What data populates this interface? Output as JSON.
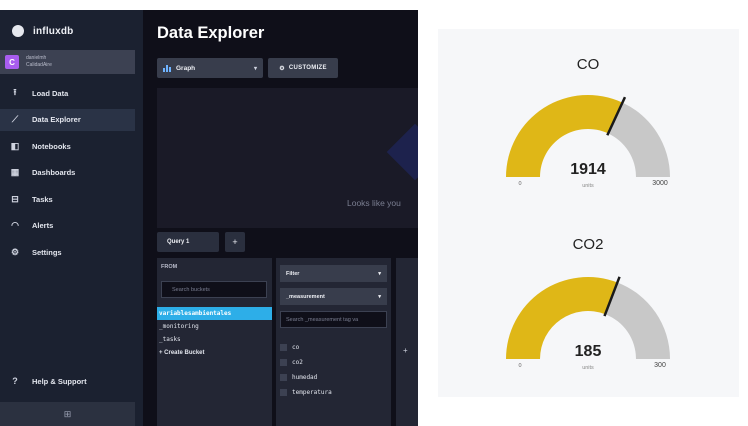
{
  "influx": {
    "brand": "influxdb",
    "org": {
      "avatar_letter": "C",
      "line1": "danielmh",
      "line2": "CalidadAire"
    },
    "nav": [
      {
        "label": "Load Data",
        "icon": "upload-icon",
        "glyph": "⭱",
        "active": false
      },
      {
        "label": "Data Explorer",
        "icon": "graph-icon",
        "glyph": "⟋",
        "active": true
      },
      {
        "label": "Notebooks",
        "icon": "notebook-icon",
        "glyph": "◧",
        "active": false
      },
      {
        "label": "Dashboards",
        "icon": "dashboard-icon",
        "glyph": "▦",
        "active": false
      },
      {
        "label": "Tasks",
        "icon": "calendar-icon",
        "glyph": "⊟",
        "active": false
      },
      {
        "label": "Alerts",
        "icon": "bell-icon",
        "glyph": "◠",
        "active": false
      },
      {
        "label": "Settings",
        "icon": "gear-icon",
        "glyph": "⚙",
        "active": false
      }
    ],
    "help_label": "Help & Support",
    "page_title": "Data Explorer",
    "graph_type": "Graph",
    "customize_label": "CUSTOMIZE",
    "empty_message": "Looks like you",
    "query_tab": "Query 1",
    "from_label": "FROM",
    "search_buckets_placeholder": "Search buckets",
    "buckets": [
      "variablesambientales",
      "_monitoring",
      "_tasks",
      "+ Create Bucket"
    ],
    "selected_bucket": 0,
    "filter_label": "Filter",
    "measurement_label": "_measurement",
    "measurement_search_placeholder": "Search _measurement tag va",
    "tags": [
      "co",
      "co2",
      "humedad",
      "temperatura"
    ]
  },
  "gauges": [
    {
      "title": "CO",
      "value": 1914,
      "min": 0,
      "max": 3000,
      "unit": "units",
      "fill_color": "#dfb717",
      "rest_color": "#c8c8c8"
    },
    {
      "title": "CO2",
      "value": 185,
      "min": 0,
      "max": 300,
      "unit": "units",
      "fill_color": "#dfb717",
      "rest_color": "#c8c8c8"
    }
  ]
}
